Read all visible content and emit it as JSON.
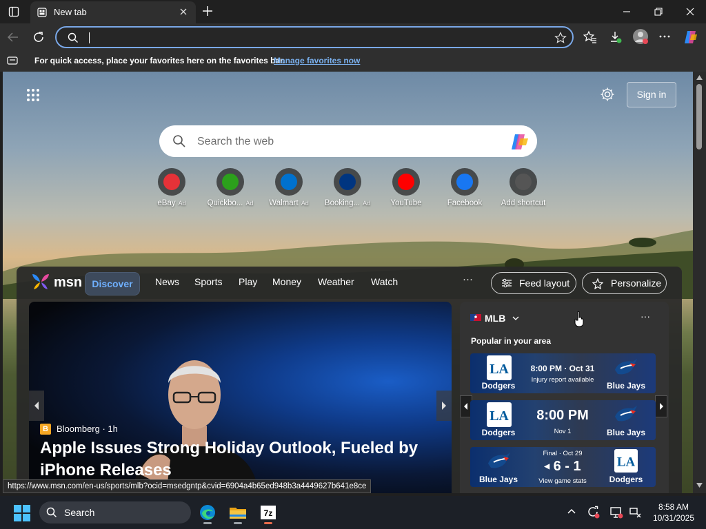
{
  "browser": {
    "tab_title": "New tab",
    "address_value": "",
    "favorites_message": "For quick access, place your favorites here on the favorites bar.",
    "favorites_link": "Manage favorites now"
  },
  "newtab": {
    "signin_label": "Sign in",
    "search_placeholder": "Search the web",
    "shortcuts": [
      {
        "label": "eBay",
        "ad": "Ad",
        "icon": "ebay-icon",
        "color": "#e53238"
      },
      {
        "label": "Quickbo...",
        "ad": "Ad",
        "icon": "quickbooks-icon",
        "color": "#2ca01c"
      },
      {
        "label": "Walmart",
        "ad": "Ad",
        "icon": "walmart-icon",
        "color": "#0071ce"
      },
      {
        "label": "Booking...",
        "ad": "Ad",
        "icon": "booking-icon",
        "color": "#003580"
      },
      {
        "label": "YouTube",
        "ad": "",
        "icon": "youtube-icon",
        "color": "#ff0000"
      },
      {
        "label": "Facebook",
        "ad": "",
        "icon": "facebook-icon",
        "color": "#1877f2"
      },
      {
        "label": "Add shortcut",
        "ad": "",
        "icon": "plus-icon",
        "color": "#555555"
      }
    ]
  },
  "msn": {
    "logo_text": "msn",
    "tabs": [
      "Discover",
      "News",
      "Sports",
      "Play",
      "Money",
      "Weather",
      "Watch"
    ],
    "more_label": "···",
    "feed_layout_label": "Feed layout",
    "personalize_label": "Personalize",
    "hero": {
      "source_badge": "B",
      "source": "Bloomberg · 1h",
      "headline": "Apple Issues Strong Holiday Outlook, Fueled by iPhone Releases"
    },
    "mlb_card": {
      "league": "MLB",
      "subtitle": "Popular in your area",
      "more": "···",
      "games": [
        {
          "team_left": "Dodgers",
          "team_right": "Blue Jays",
          "line1": "8:00 PM · Oct 31",
          "line2": "Injury report available",
          "style": "small"
        },
        {
          "team_left": "Dodgers",
          "team_right": "Blue Jays",
          "line1": "8:00 PM",
          "line2": "Nov 1",
          "style": "big"
        },
        {
          "team_left": "Blue Jays",
          "team_right": "Dodgers",
          "line0": "Final · Oct 29",
          "line1": "6 - 1",
          "line2": "View game stats",
          "style": "final"
        }
      ]
    }
  },
  "status_url": "https://www.msn.com/en-us/sports/mlb?ocid=msedgntp&cvid=6904a4b65ed948b3a4449627b641e8ce",
  "taskbar": {
    "search_label": "Search",
    "time": "8:58 AM",
    "date": "10/31/2025"
  },
  "colors": {
    "accent": "#7aa8e8",
    "link": "#7ab0ee",
    "discover": "#6fb0ff"
  }
}
